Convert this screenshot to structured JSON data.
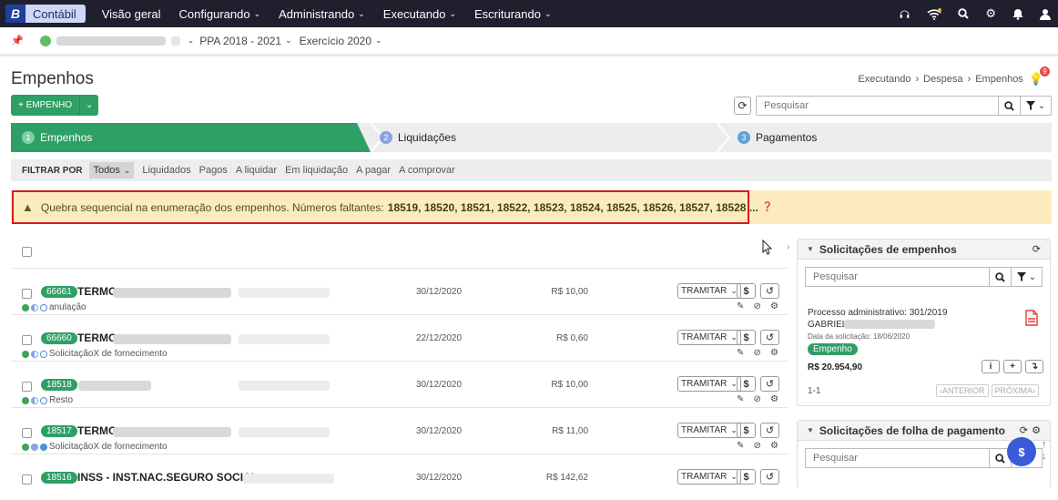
{
  "topbar": {
    "brand_letter": "B",
    "brand_name": "Contábil",
    "nav": [
      "Visão geral",
      "Configurando",
      "Administrando",
      "Executando",
      "Escriturando"
    ]
  },
  "context": {
    "ppa": "PPA 2018 - 2021",
    "exercicio": "Exercício 2020"
  },
  "page": {
    "title": "Empenhos",
    "breadcrumb": [
      "Executando",
      "Despesa",
      "Empenhos"
    ],
    "notification_count": "9",
    "new_button": "+ EMPENHO",
    "search_placeholder": "Pesquisar"
  },
  "steps": [
    {
      "num": "1",
      "label": "Empenhos"
    },
    {
      "num": "2",
      "label": "Liquidações"
    },
    {
      "num": "3",
      "label": "Pagamentos"
    }
  ],
  "filter": {
    "label": "FILTRAR POR",
    "active": "Todos",
    "options": [
      "Liquidados",
      "Pagos",
      "A liquidar",
      "Em liquidação",
      "A pagar",
      "A comprovar"
    ]
  },
  "alert": {
    "text": "Quebra sequencial na enumeração dos empenhos. Números faltantes:",
    "numbers": "18519, 18520, 18521, 18522, 18523, 18524, 18525, 18526, 18527, 18528 ..."
  },
  "rows": [
    {
      "num": "66661",
      "name": "TERMO",
      "sub": "anulação",
      "date": "30/12/2020",
      "value": "R$ 10,00",
      "tramitar": "TRAMITAR"
    },
    {
      "num": "66660",
      "name": "TERMO",
      "sub": "SolicitaçãoX de fornecimento",
      "date": "22/12/2020",
      "value": "R$ 0,60",
      "tramitar": "TRAMITAR"
    },
    {
      "num": "18518",
      "name": "",
      "sub": "Resto",
      "date": "30/12/2020",
      "value": "R$ 10,00",
      "tramitar": "TRAMITAR"
    },
    {
      "num": "18517",
      "name": "TERMO",
      "sub": "SolicitaçãoX de fornecimento",
      "date": "30/12/2020",
      "value": "R$ 11,00",
      "tramitar": "TRAMITAR"
    },
    {
      "num": "18516",
      "name": "INSS - INST.NAC.SEGURO SOCIAL",
      "sub": "",
      "date": "30/12/2020",
      "value": "R$ 142,62",
      "tramitar": "TRAMITAR"
    }
  ],
  "panel_emp": {
    "title": "Solicitações de empenhos",
    "search_placeholder": "Pesquisar",
    "process": "Processo administrativo: 301/2019",
    "person": "GABRIEL",
    "request_date": "Data da solicitação: 18/06/2020",
    "badge": "Empenho",
    "amount": "R$ 20.954,90",
    "pager": "1-1",
    "prev": "‹ANTERIOR",
    "next": "PRÓXIMA›"
  },
  "panel_folha": {
    "title": "Solicitações de folha de pagamento",
    "search_placeholder": "Pesquisar"
  },
  "fab_label": "$"
}
